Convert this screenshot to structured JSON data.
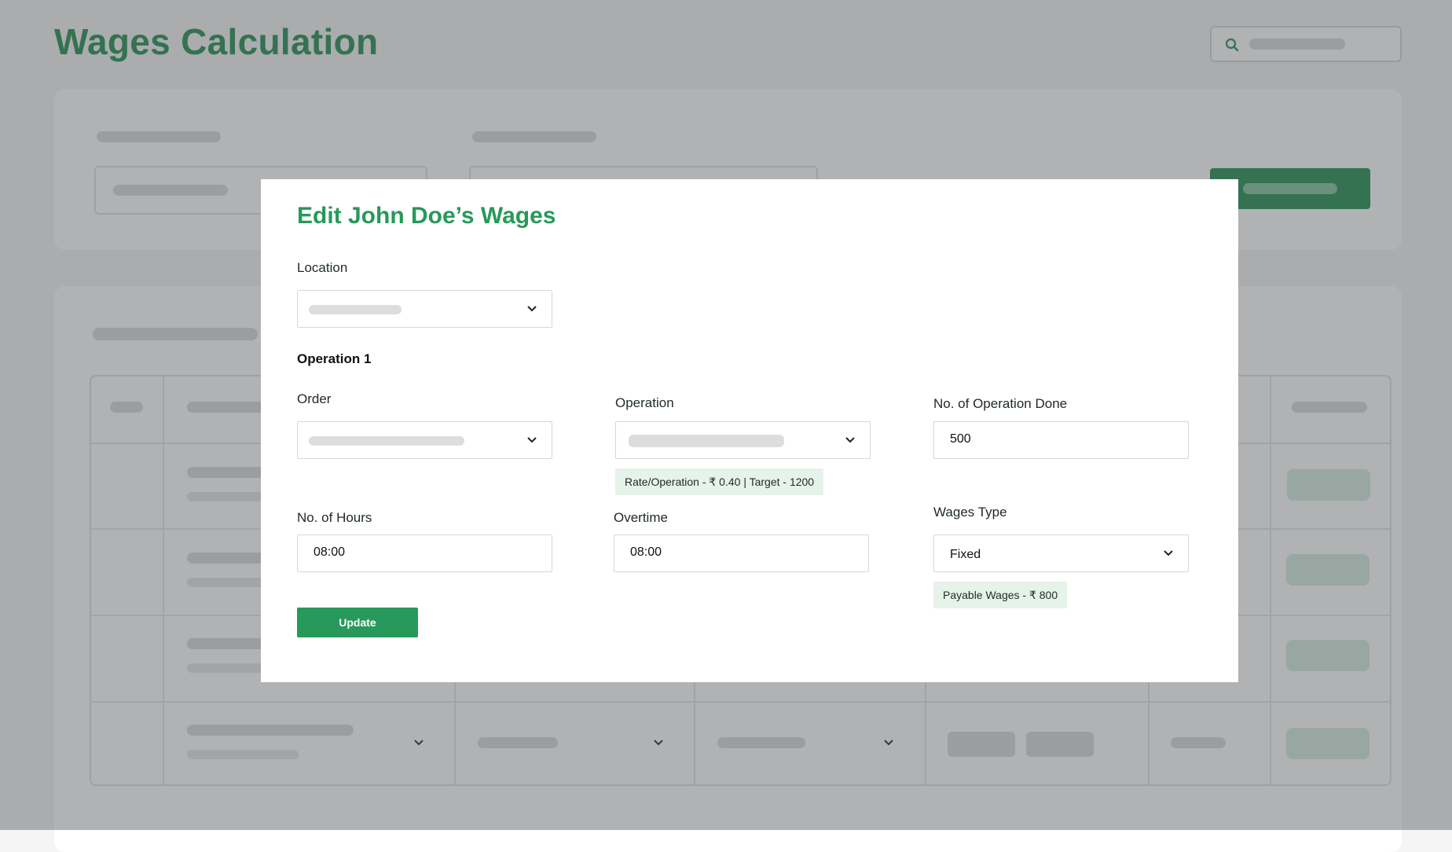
{
  "page": {
    "title": "Wages Calculation"
  },
  "modal": {
    "title": "Edit John Doe’s Wages",
    "location": {
      "label": "Location"
    },
    "operation_section": "Operation 1",
    "order": {
      "label": "Order"
    },
    "operation": {
      "label": "Operation",
      "info": "Rate/Operation - ₹ 0.40 | Target - 1200"
    },
    "operations_done": {
      "label": "No. of Operation Done",
      "value": "500"
    },
    "hours": {
      "label": "No. of Hours",
      "value": "08:00"
    },
    "overtime": {
      "label": "Overtime",
      "value": "08:00"
    },
    "wages_type": {
      "label": "Wages Type",
      "value": "Fixed",
      "info": "Payable Wages - ₹ 800"
    },
    "update_label": "Update"
  },
  "colors": {
    "brand_green": "#27995a",
    "title_green": "#1e8a4c",
    "chip_bg": "#e6f3ea"
  },
  "icons": {
    "search": "search-icon",
    "dropdown": "chevron-down-icon"
  }
}
